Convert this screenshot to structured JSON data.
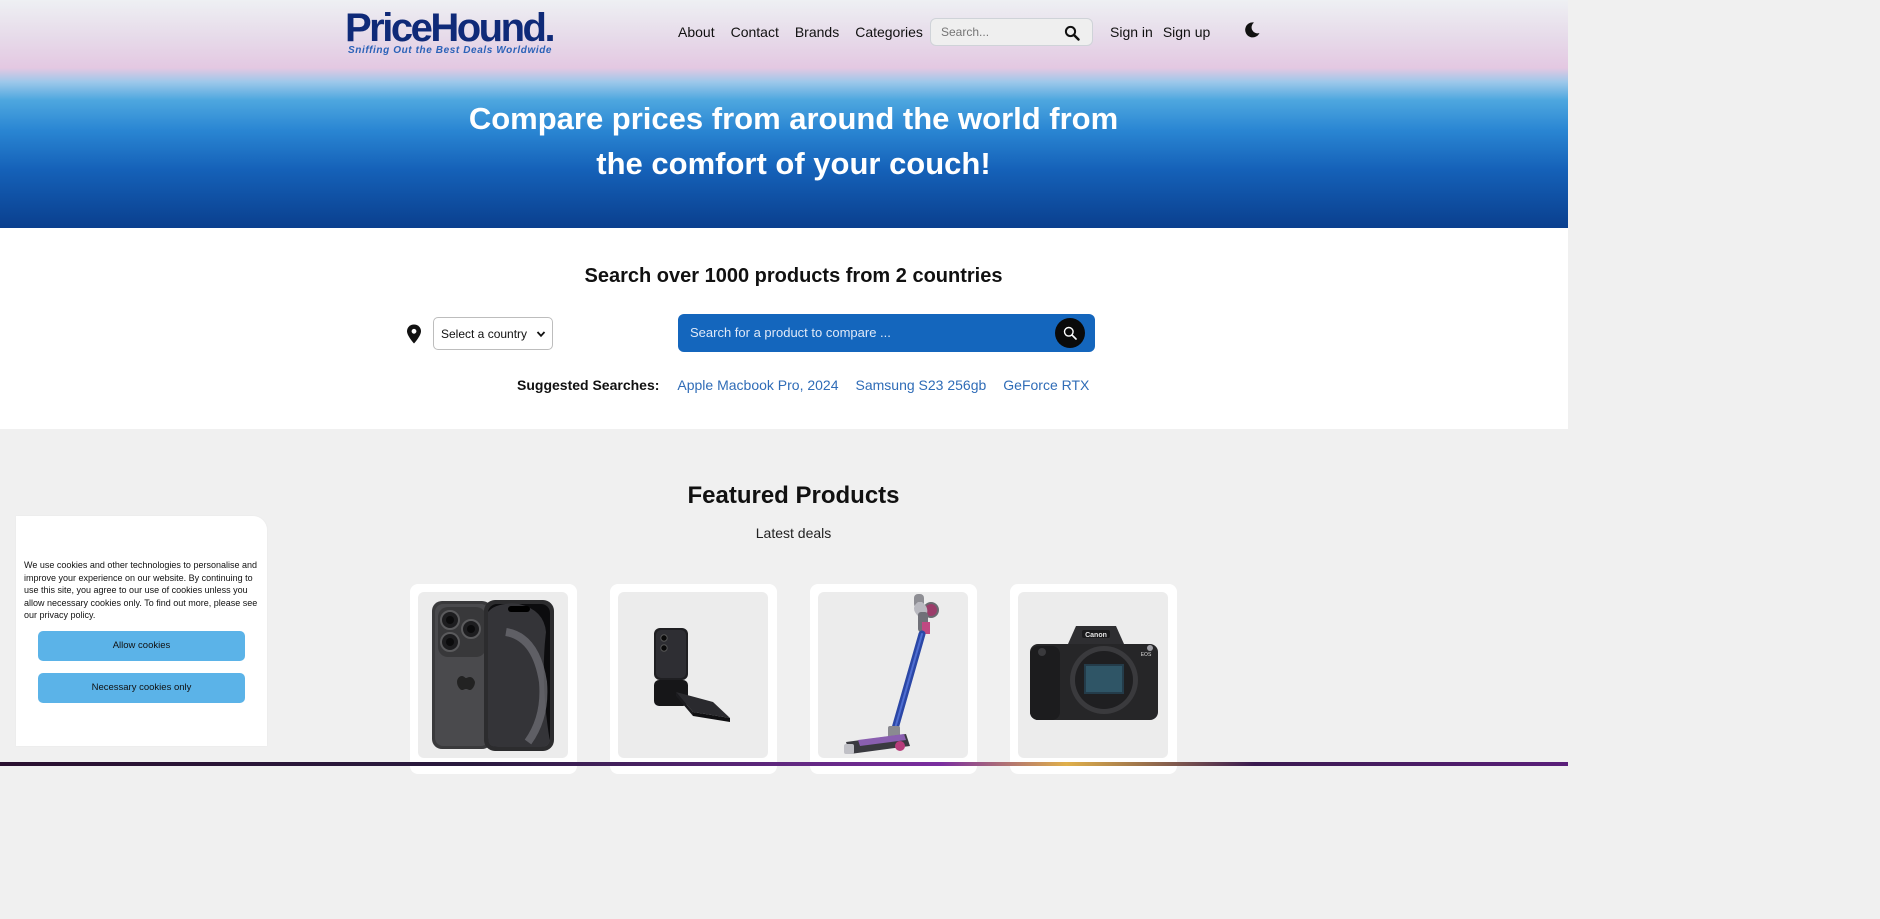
{
  "brand": {
    "name": "PriceHound.",
    "tagline": "Sniffing Out the Best Deals Worldwide"
  },
  "nav": {
    "items": [
      "About",
      "Contact",
      "Brands",
      "Categories"
    ],
    "search_placeholder": "Search...",
    "sign_in": "Sign in",
    "sign_up": "Sign up"
  },
  "hero": {
    "title_line1": "Compare prices from around the world from",
    "title_line2": "the comfort of your couch!"
  },
  "search_section": {
    "heading": "Search over 1000 products from 2 countries",
    "country_select": "Select a country",
    "search_placeholder": "Search for a product to compare ...",
    "suggested_label": "Suggested Searches:",
    "suggestions": [
      "Apple Macbook Pro, 2024",
      "Samsung S23 256gb",
      "GeForce RTX"
    ]
  },
  "featured": {
    "heading": "Featured Products",
    "subheading": "Latest deals",
    "products": [
      {
        "image": "iphone-image"
      },
      {
        "image": "flip-phone-image"
      },
      {
        "image": "stick-vacuum-image"
      },
      {
        "image": "camera-image"
      }
    ]
  },
  "cookie_banner": {
    "text": "We use cookies and other technologies to personalise and improve your experience on our website. By continuing to use this site, you agree to our use of cookies unless you allow necessary cookies only. To find out more, please see our privacy policy.",
    "allow_label": "Allow cookies",
    "necessary_label": "Necessary cookies only"
  },
  "colors": {
    "accent_blue": "#1466bd",
    "cookie_button": "#5bb3e8",
    "link": "#2f6cb7",
    "logo_navy": "#0f2a78"
  }
}
